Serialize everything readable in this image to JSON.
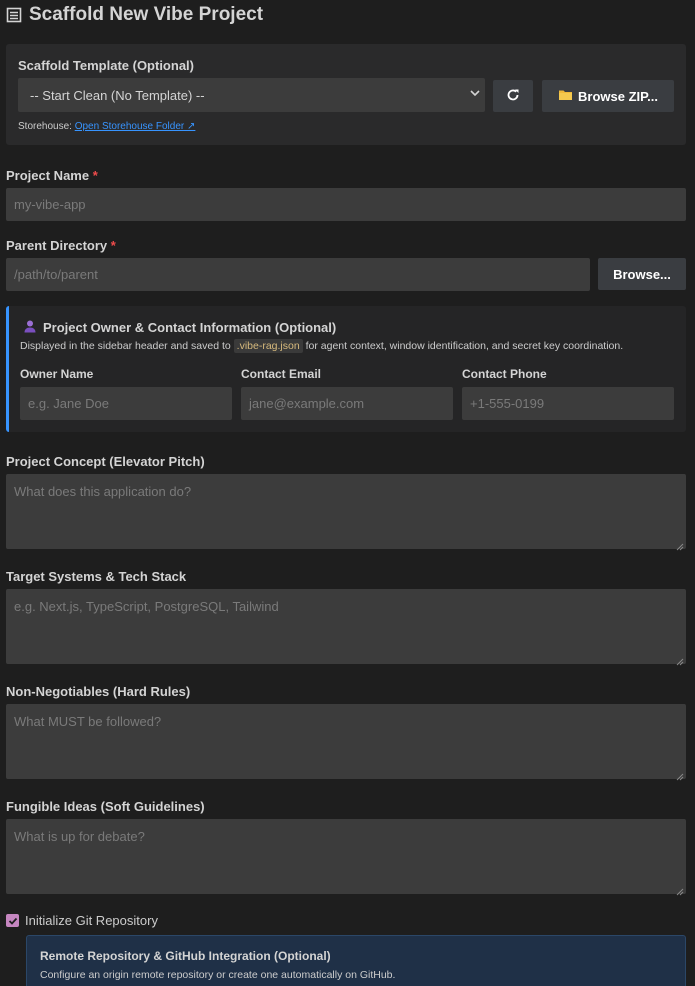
{
  "header": {
    "title": "Scaffold New Vibe Project",
    "icon": "document-icon"
  },
  "scaffold": {
    "label": "Scaffold Template (Optional)",
    "selected": "-- Start Clean (No Template) --",
    "browse_zip_label": "Browse ZIP...",
    "refresh_icon": "refresh-icon",
    "folder_icon": "folder-icon",
    "storehouse_label": "Storehouse:",
    "storehouse_link": "Open Storehouse Folder ↗"
  },
  "project_name": {
    "label": "Project Name",
    "required": "*",
    "placeholder": "my-vibe-app"
  },
  "parent_dir": {
    "label": "Parent Directory",
    "required": "*",
    "placeholder": "/path/to/parent",
    "browse_label": "Browse..."
  },
  "owner": {
    "title": "Project Owner & Contact Information (Optional)",
    "icon": "person-icon",
    "desc_pre": "Displayed in the sidebar header and saved to",
    "desc_code": ".vibe-rag.json",
    "desc_post": "for agent context, window identification, and secret key coordination.",
    "fields": [
      {
        "label": "Owner Name",
        "placeholder": "e.g. Jane Doe"
      },
      {
        "label": "Contact Email",
        "placeholder": "jane@example.com"
      },
      {
        "label": "Contact Phone",
        "placeholder": "+1-555-0199"
      }
    ]
  },
  "concept": {
    "label": "Project Concept (Elevator Pitch)",
    "placeholder": "What does this application do?"
  },
  "tech": {
    "label": "Target Systems & Tech Stack",
    "placeholder": "e.g. Next.js, TypeScript, PostgreSQL, Tailwind"
  },
  "rules": {
    "label": "Non-Negotiables (Hard Rules)",
    "placeholder": "What MUST be followed?"
  },
  "ideas": {
    "label": "Fungible Ideas (Soft Guidelines)",
    "placeholder": "What is up for debate?"
  },
  "git": {
    "label": "Initialize Git Repository",
    "checked": true
  },
  "remote": {
    "title": "Remote Repository & GitHub Integration (Optional)",
    "desc": "Configure an origin remote repository or create one automatically on GitHub."
  },
  "colors": {
    "accent": "#3794ff",
    "required": "#f14c4c",
    "checkbox": "#c586c0"
  }
}
